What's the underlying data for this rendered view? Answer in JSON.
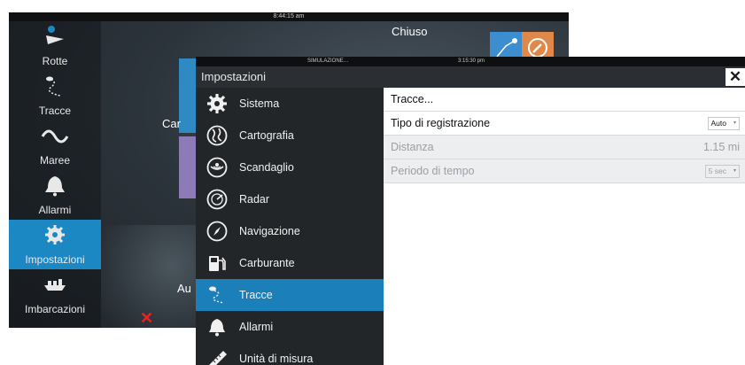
{
  "background": {
    "clock": "8:44:15 am",
    "closed_label": "Chiuso",
    "tile_label_1": "Car",
    "tile_label_2": "Au",
    "nav": [
      {
        "label": "Rotte",
        "icon": "routes-icon"
      },
      {
        "label": "Tracce",
        "icon": "tracks-icon"
      },
      {
        "label": "Maree",
        "icon": "tides-icon"
      },
      {
        "label": "Allarmi",
        "icon": "bell-icon"
      },
      {
        "label": "Impostazioni",
        "icon": "gear-icon",
        "active": true
      },
      {
        "label": "Imbarcazioni",
        "icon": "vessels-icon"
      }
    ]
  },
  "dialog": {
    "status_left": "SIMULAZIONE…",
    "status_time": "3:15:30 pm",
    "title": "Impostazioni",
    "close_symbol": "✕",
    "menu": [
      {
        "label": "Sistema",
        "icon": "gear-icon"
      },
      {
        "label": "Cartografia",
        "icon": "chart-icon"
      },
      {
        "label": "Scandaglio",
        "icon": "sonar-icon"
      },
      {
        "label": "Radar",
        "icon": "radar-icon"
      },
      {
        "label": "Navigazione",
        "icon": "compass-icon"
      },
      {
        "label": "Carburante",
        "icon": "fuel-icon"
      },
      {
        "label": "Tracce",
        "icon": "tracks-icon",
        "selected": true
      },
      {
        "label": "Allarmi",
        "icon": "bell-icon"
      },
      {
        "label": "Unità di misura",
        "icon": "ruler-icon"
      }
    ],
    "content": {
      "tracks_link": "Tracce...",
      "logging_type_label": "Tipo di registrazione",
      "logging_type_value": "Auto",
      "distance_label": "Distanza",
      "distance_value": "1.15 mi",
      "time_period_label": "Periodo di tempo",
      "time_period_value": "5 sec"
    }
  },
  "colors": {
    "accent": "#1b7fba",
    "menu_bg": "#222629",
    "titlebar_bg": "#2b2f33",
    "alert_red": "#e0282a"
  }
}
